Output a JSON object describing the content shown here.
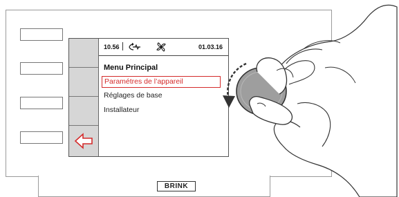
{
  "screen": {
    "status": {
      "time": "10.56",
      "date": "01.03.16",
      "icons": [
        "recirculation-icon",
        "fan-icon"
      ]
    },
    "menu": {
      "title": "Menu Principal",
      "items": [
        {
          "label": "Paramétres de l’appareil",
          "selected": true
        },
        {
          "label": "Réglages de base",
          "selected": false
        },
        {
          "label": "Installateur",
          "selected": false
        }
      ]
    },
    "softkeys": [
      "",
      "",
      "",
      "back-arrow-icon"
    ]
  },
  "device": {
    "brand": "BRINK",
    "side_buttons": 4,
    "rotary_knob": "rotary-knob",
    "gesture": "rotate-counterclockwise"
  },
  "colors": {
    "accent": "#d42a2a",
    "softkey_bg": "#d6d6d6",
    "knob": "#9e9e9e",
    "outline": "#333333"
  }
}
